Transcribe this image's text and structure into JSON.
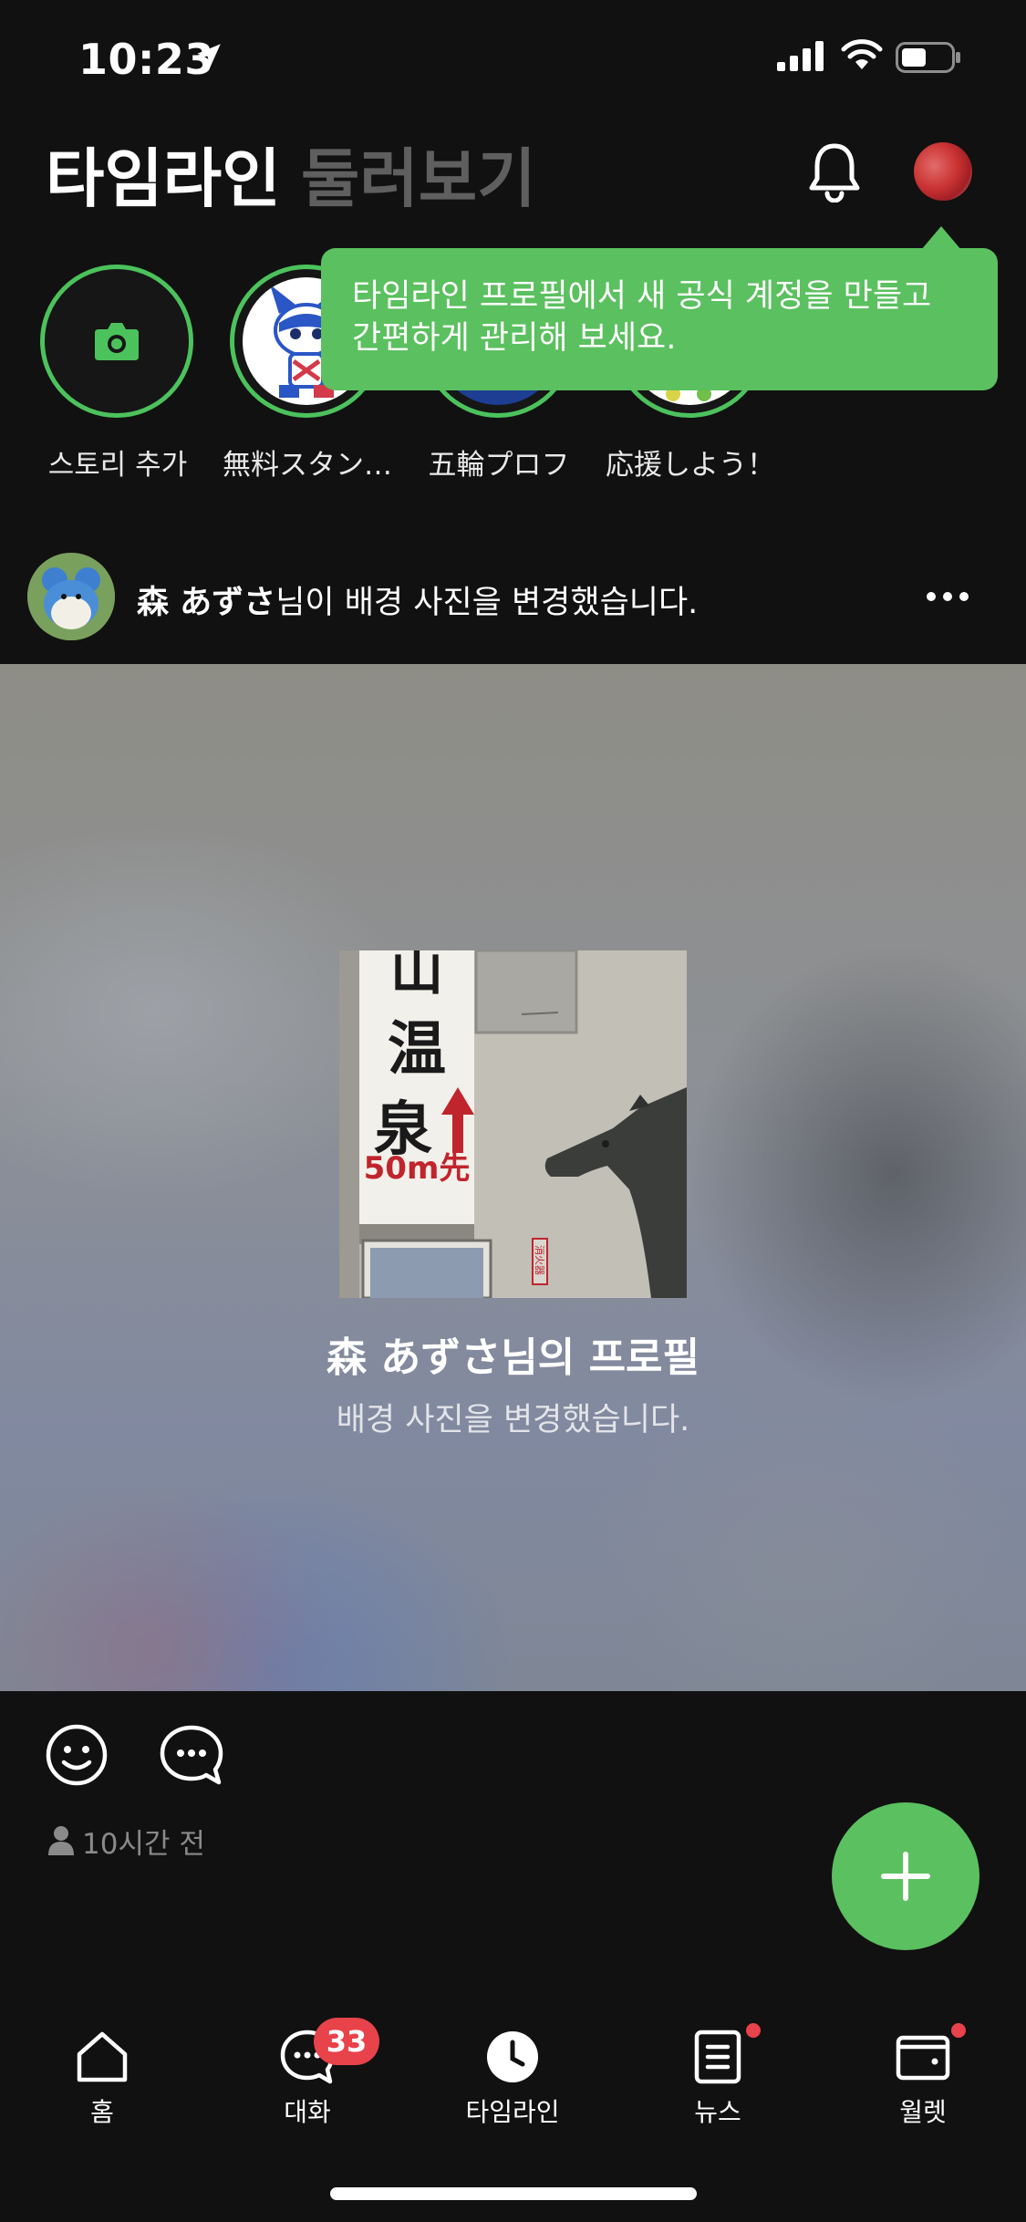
{
  "status_bar": {
    "time": "10:23"
  },
  "header": {
    "tab_active": "타임라인",
    "tab_inactive": "둘러보기"
  },
  "tooltip": {
    "line1": "타임라인 프로필에서 새 공식 계정을 만들고",
    "line2": "간편하게 관리해 보세요."
  },
  "stories": [
    {
      "label": "스토리 추가",
      "icon": "camera-icon"
    },
    {
      "label": "無料スタン…",
      "icon": "mascot-avatar"
    },
    {
      "label": "五輪プロフ",
      "icon": "story-avatar"
    },
    {
      "label": "応援しよう！",
      "icon": "story-avatar"
    }
  ],
  "post": {
    "author": "森 あずさ",
    "action": "님이 배경 사진을 변경했습니다.",
    "profile_title": "森 あずさ님의 프로필",
    "profile_subtitle": "배경 사진을 변경했습니다.",
    "photo_sign_chars": [
      "山",
      "温",
      "泉"
    ],
    "photo_sign_distance": "50m先",
    "photo_small_sign": "消火器",
    "time_ago": "10시간 전"
  },
  "bottom_nav": {
    "items": [
      {
        "label": "홈",
        "icon": "home-icon"
      },
      {
        "label": "대화",
        "icon": "chat-icon",
        "badge": "33"
      },
      {
        "label": "타임라인",
        "icon": "timeline-clock-icon",
        "active": true
      },
      {
        "label": "뉴스",
        "icon": "news-icon",
        "dot": true
      },
      {
        "label": "월렛",
        "icon": "wallet-icon",
        "dot": true
      }
    ]
  },
  "colors": {
    "accent": "#5bc05f",
    "badge": "#e8424a",
    "background": "#111111",
    "inactive_tab": "#5f5f5f"
  }
}
